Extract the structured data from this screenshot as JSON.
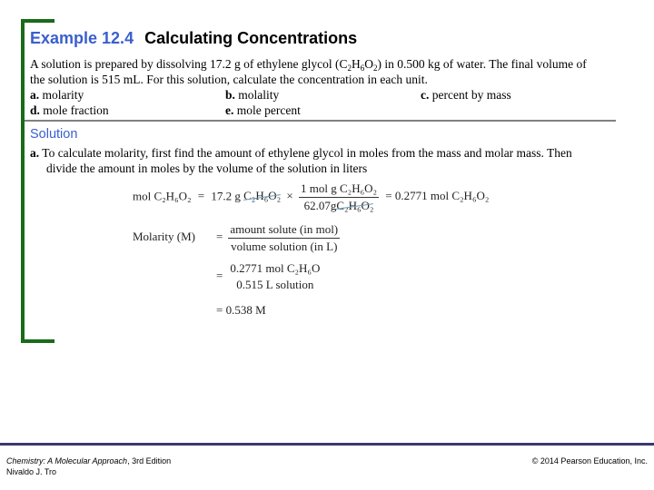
{
  "example": {
    "number": "Example 12.4",
    "title": "Calculating Concentrations"
  },
  "problem": {
    "line1_pre": "A solution is prepared by dissolving 17.2 g of ethylene glycol (C",
    "line1_sub1": "2",
    "line1_mid1": "H",
    "line1_sub2": "6",
    "line1_mid2": "O",
    "line1_sub3": "2",
    "line1_post": ") in 0.500 kg of water. The final volume of",
    "line2": "the solution is 515 mL. For this solution, calculate the concentration in each unit.",
    "options": [
      {
        "letter": "a.",
        "label": "molarity"
      },
      {
        "letter": "b.",
        "label": "molality"
      },
      {
        "letter": "c.",
        "label": "percent by mass"
      },
      {
        "letter": "d.",
        "label": "mole fraction"
      },
      {
        "letter": "e.",
        "label": "mole percent"
      }
    ]
  },
  "solution": {
    "heading": "Solution",
    "part_a_letter": "a.",
    "part_a_line1": "To calculate molarity, first find the amount of ethylene glycol in moles from the mass and molar mass. Then",
    "part_a_line2": "divide the amount in moles by the volume of the solution in liters",
    "eq1": {
      "lhs": "mol C₂H₆O₂",
      "eq": "=",
      "given": "17.2 g",
      "given_unit": "C₂H₆O₂",
      "times": "×",
      "num": "1 mol g C₂H₆O₂",
      "den_val": "62.07g",
      "den_unit": "C₂H₆O₂",
      "result": "= 0.2771 mol C₂H₆O₂"
    },
    "eq2": {
      "lhs": "Molarity (M)",
      "eq": "=",
      "num": "amount solute (in mol)",
      "den": "volume solution (in L)"
    },
    "eq3": {
      "eq": "=",
      "num": "0.2771 mol C₂H₆O",
      "den": "0.515 L solution"
    },
    "eq4": {
      "result": "= 0.538 M"
    }
  },
  "footer": {
    "book_title": "Chemistry: A Molecular Approach",
    "edition": ", 3rd Edition",
    "author": "Nivaldo J. Tro",
    "copyright": "© 2014 Pearson Education, Inc."
  }
}
